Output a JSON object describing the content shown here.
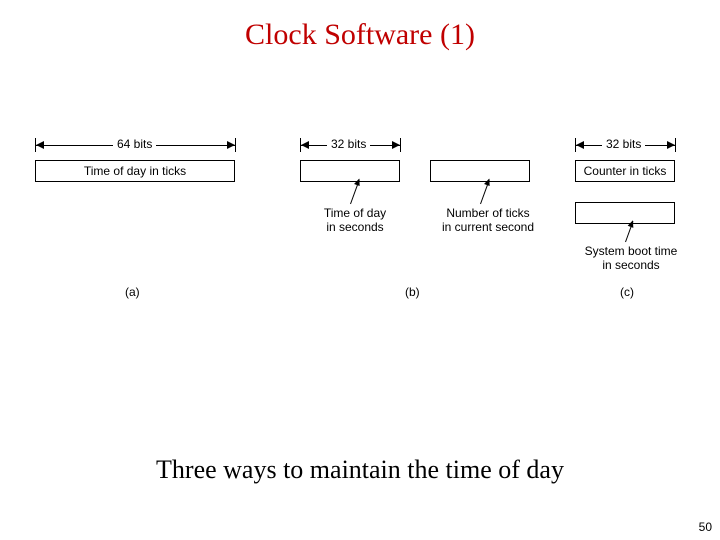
{
  "title": "Clock Software (1)",
  "caption": "Three ways to maintain the time of day",
  "page_number": "50",
  "fig_a": {
    "width_label": "64 bits",
    "box_label": "Time of day in ticks",
    "tag": "(a)"
  },
  "fig_b": {
    "width_label": "32 bits",
    "annot_left": "Time of day\nin seconds",
    "annot_right": "Number of ticks\nin current second",
    "tag": "(b)"
  },
  "fig_c": {
    "width_label": "32 bits",
    "box_top_label": "Counter in ticks",
    "annot_bottom": "System boot time\nin seconds",
    "tag": "(c)"
  }
}
